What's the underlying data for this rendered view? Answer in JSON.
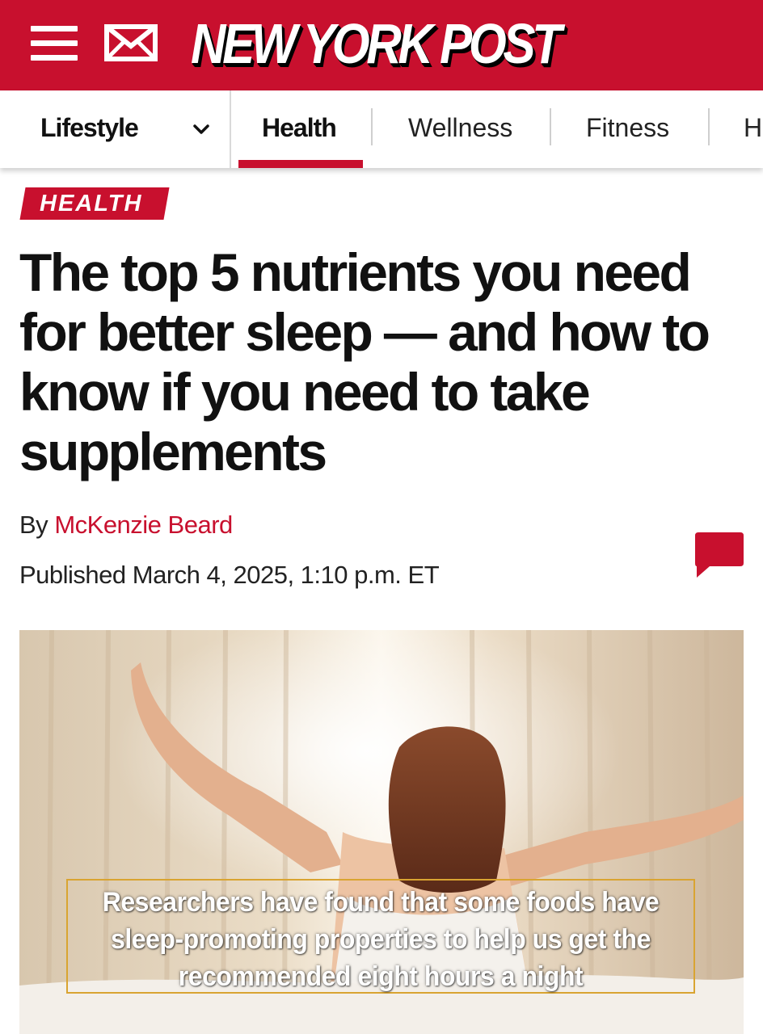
{
  "header": {
    "logo_text": "NEW YORK POST",
    "brand_color": "#c8102e",
    "menu_icon": "hamburger-icon",
    "mail_icon": "envelope-icon"
  },
  "nav": {
    "section": "Lifestyle",
    "tabs": [
      {
        "label": "Health",
        "active": true
      },
      {
        "label": "Wellness",
        "active": false
      },
      {
        "label": "Fitness",
        "active": false
      },
      {
        "label": "H",
        "active": false
      }
    ]
  },
  "article": {
    "section_tag": "HEALTH",
    "headline": "The top 5 nutrients you need for better sleep — and how to know if you need to take supplements",
    "byline_prefix": "By",
    "author": "McKenzie Beard",
    "published": "Published March 4, 2025, 1:10 p.m. ET",
    "comment_icon": "comment-bubble-icon",
    "image_caption": "Researchers have found that some foods have sleep-promoting properties to help us get the recommended eight hours a night"
  }
}
